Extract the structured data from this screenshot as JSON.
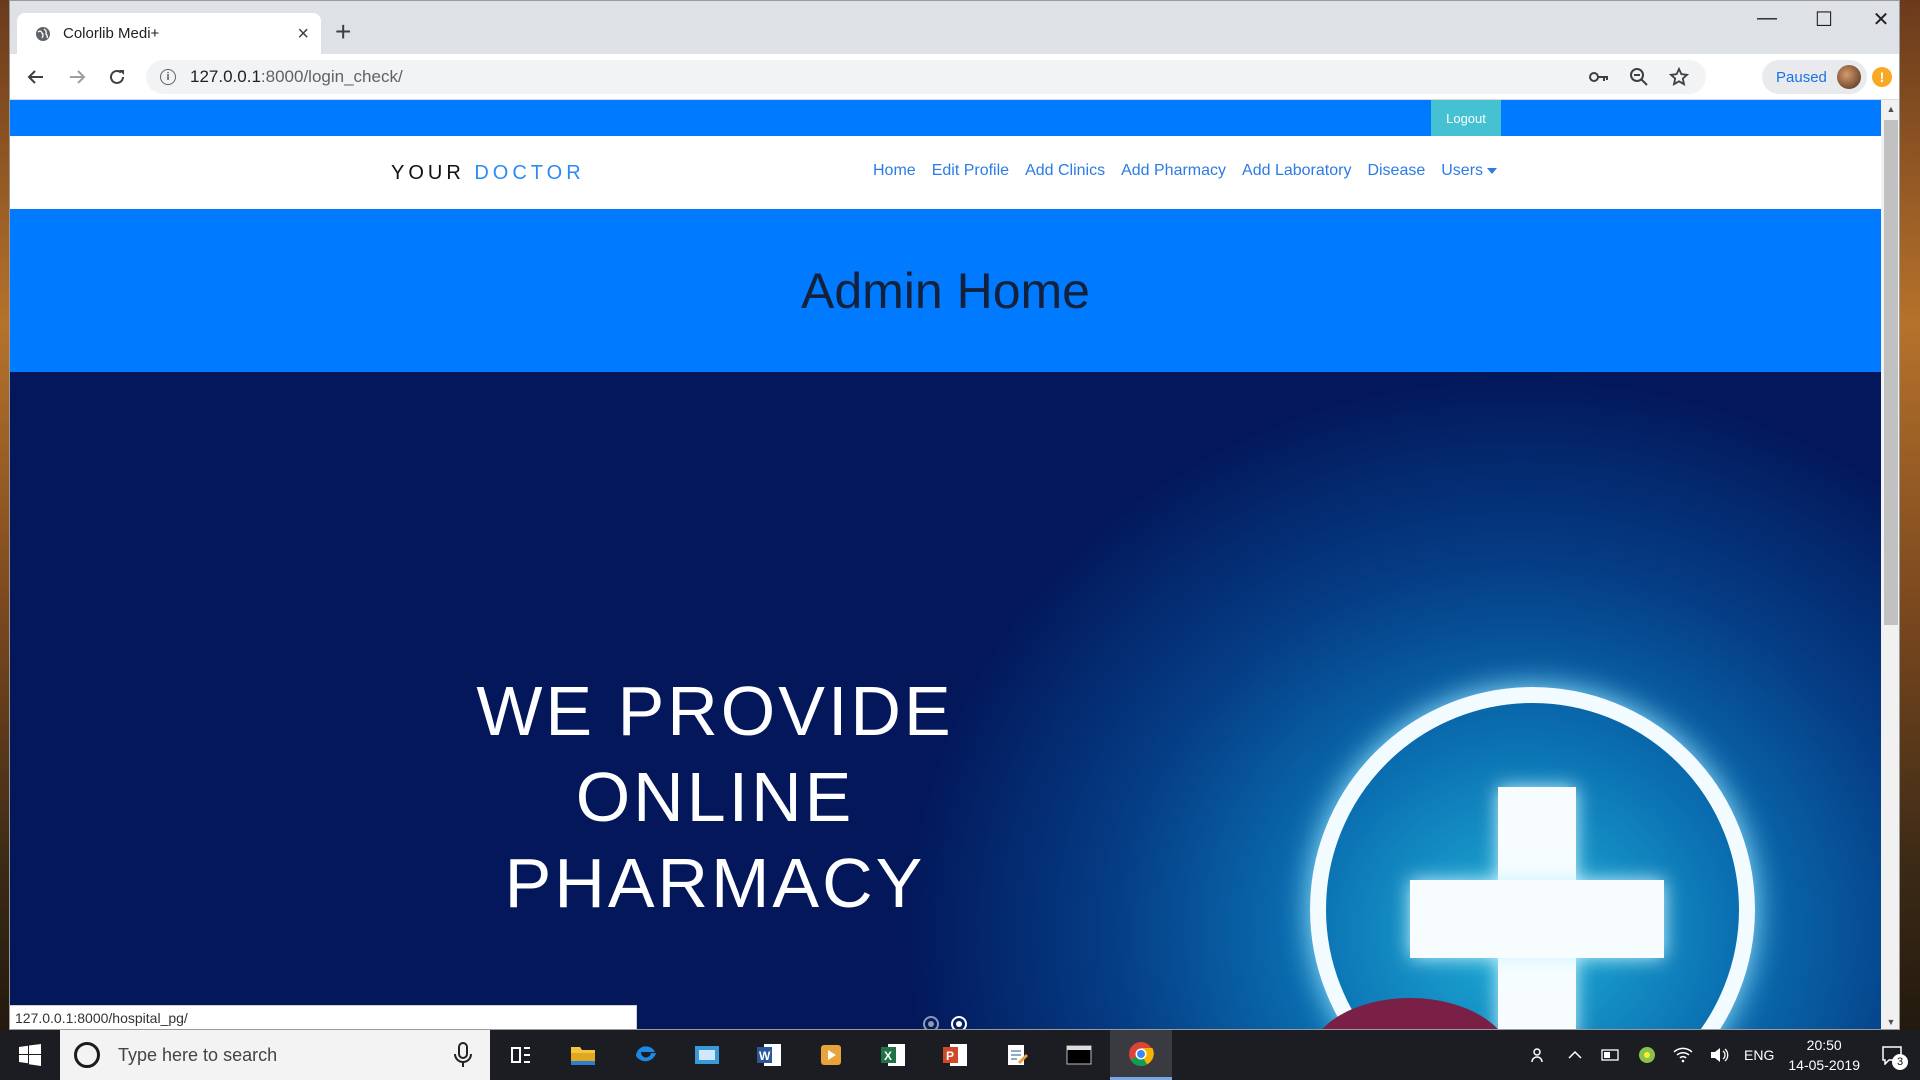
{
  "browser": {
    "tab_title": "Colorlib Medi+",
    "tab_close": "×",
    "new_tab": "+",
    "url_host": "127.0.0.1",
    "url_path": ":8000/login_check/",
    "profile_label": "Paused",
    "alert_badge": "!",
    "status_url": "127.0.0.1:8000/hospital_pg/",
    "window_controls": {
      "minimize": "—",
      "maximize": "☐",
      "close": "✕"
    }
  },
  "site": {
    "logout_label": "Logout",
    "brand_first": "YOUR",
    "brand_second": "DOCTOR",
    "nav": [
      {
        "label": "Home"
      },
      {
        "label": "Edit Profile"
      },
      {
        "label": "Add Clinics"
      },
      {
        "label": "Add Pharmacy"
      },
      {
        "label": "Add Laboratory"
      },
      {
        "label": "Disease"
      },
      {
        "label": "Users"
      }
    ],
    "page_heading": "Admin Home",
    "slide_lines": [
      "WE PROVIDE",
      "ONLINE",
      "PHARMACY"
    ],
    "slide_count": 2,
    "active_slide": 2
  },
  "taskbar": {
    "search_placeholder": "Type here to search",
    "language": "ENG",
    "time": "20:50",
    "date": "14-05-2019",
    "notification_count": "3"
  },
  "colors": {
    "primary_blue": "#007bff",
    "logout_teal": "#45c1d1",
    "nav_link": "#2c7be5",
    "heading_dark": "#14213d"
  }
}
